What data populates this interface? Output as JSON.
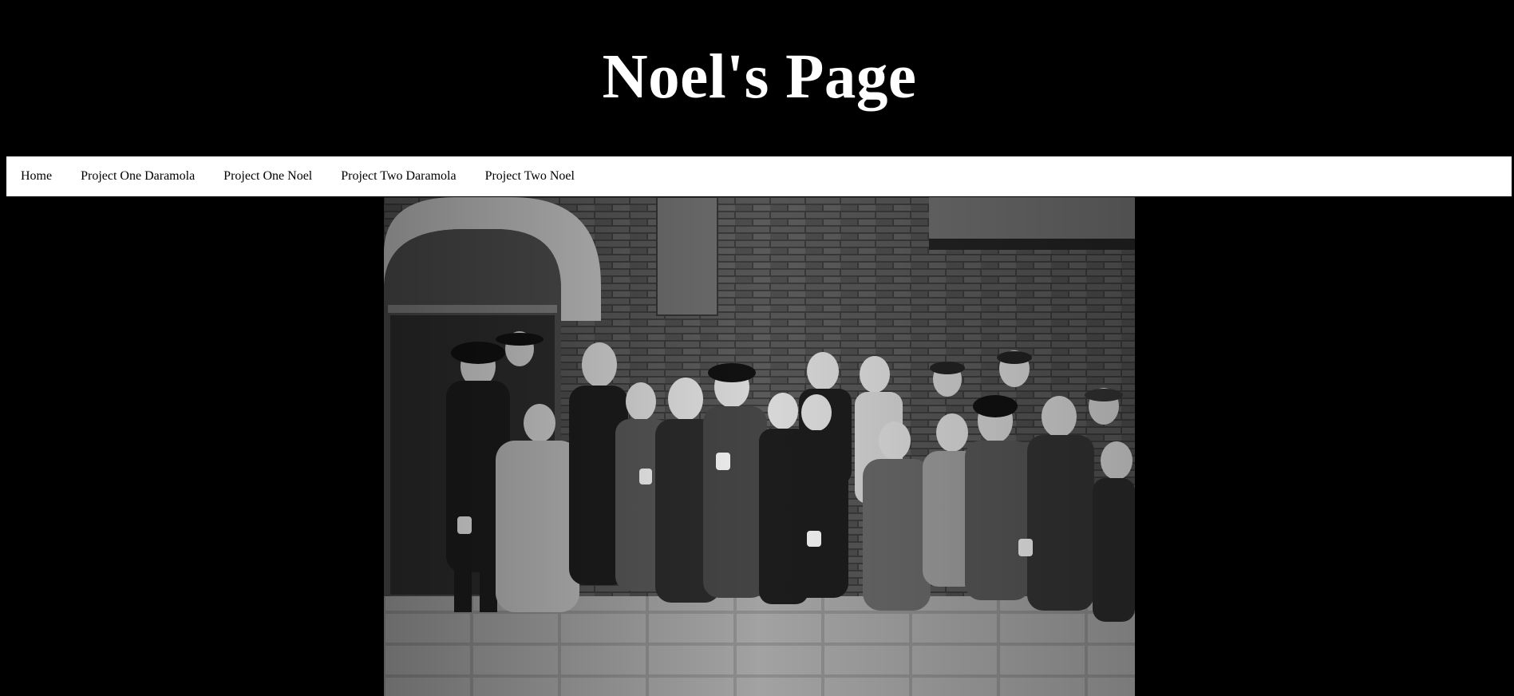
{
  "header": {
    "title": "Noel's Page"
  },
  "nav": {
    "items": [
      {
        "label": "Home"
      },
      {
        "label": "Project One Daramola"
      },
      {
        "label": "Project One Noel"
      },
      {
        "label": "Project Two Daramola"
      },
      {
        "label": "Project Two Noel"
      }
    ]
  },
  "hero": {
    "description_icon": "photo-children-in-line-icon",
    "colors": {
      "background": "#000000",
      "nav_background": "#ffffff",
      "title_color": "#ffffff"
    }
  }
}
